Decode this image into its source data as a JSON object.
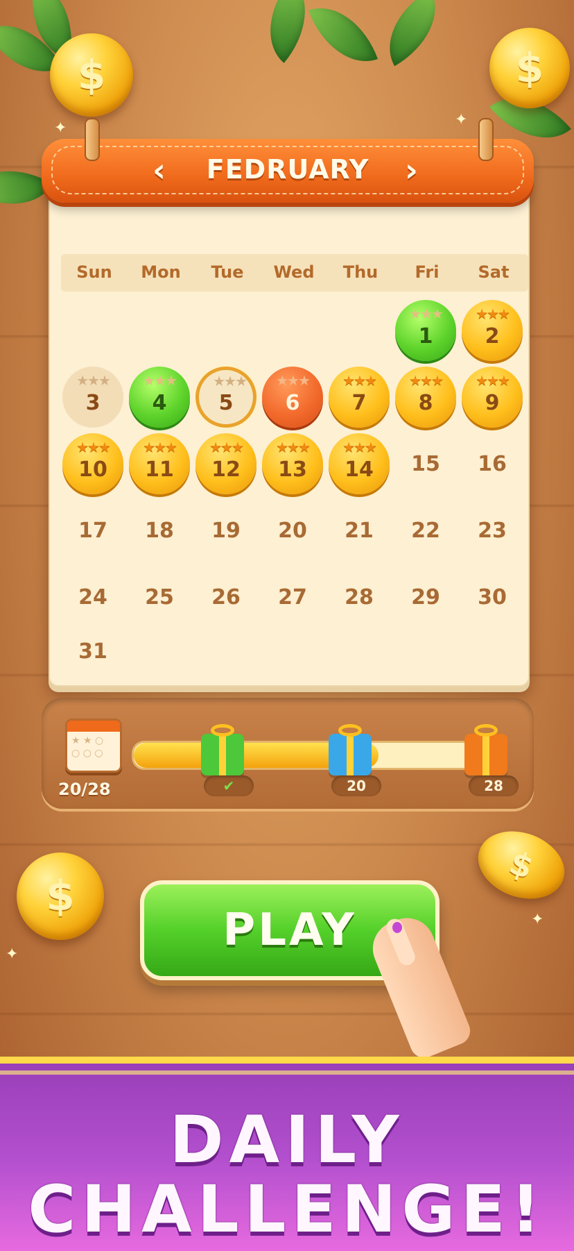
{
  "calendar": {
    "month": "FEDRUARY",
    "prev_label": "‹",
    "next_label": "›",
    "weekdays": [
      "Sun",
      "Mon",
      "Tue",
      "Wed",
      "Thu",
      "Fri",
      "Sat"
    ],
    "days": [
      {
        "num": "1",
        "state": "green",
        "stars": "★★★"
      },
      {
        "num": "2",
        "state": "gold",
        "stars": "★★★"
      },
      {
        "num": "3",
        "state": "pale",
        "stars": "★★★"
      },
      {
        "num": "4",
        "state": "green",
        "stars": "★★★"
      },
      {
        "num": "5",
        "state": "today",
        "stars": "★★★"
      },
      {
        "num": "6",
        "state": "red",
        "stars": "★★★"
      },
      {
        "num": "7",
        "state": "gold",
        "stars": "★★★"
      },
      {
        "num": "8",
        "state": "gold",
        "stars": "★★★"
      },
      {
        "num": "9",
        "state": "gold",
        "stars": "★★★"
      },
      {
        "num": "10",
        "state": "gold",
        "stars": "★★★"
      },
      {
        "num": "11",
        "state": "gold",
        "stars": "★★★"
      },
      {
        "num": "12",
        "state": "gold",
        "stars": "★★★"
      },
      {
        "num": "13",
        "state": "gold",
        "stars": "★★★"
      },
      {
        "num": "14",
        "state": "gold",
        "stars": "★★★"
      },
      {
        "num": "15",
        "state": "plain",
        "stars": ""
      },
      {
        "num": "16",
        "state": "plain",
        "stars": ""
      },
      {
        "num": "17",
        "state": "plain",
        "stars": ""
      },
      {
        "num": "18",
        "state": "plain",
        "stars": ""
      },
      {
        "num": "19",
        "state": "plain",
        "stars": ""
      },
      {
        "num": "20",
        "state": "plain",
        "stars": ""
      },
      {
        "num": "21",
        "state": "plain",
        "stars": ""
      },
      {
        "num": "22",
        "state": "plain",
        "stars": ""
      },
      {
        "num": "23",
        "state": "plain",
        "stars": ""
      },
      {
        "num": "24",
        "state": "plain",
        "stars": ""
      },
      {
        "num": "25",
        "state": "plain",
        "stars": ""
      },
      {
        "num": "26",
        "state": "plain",
        "stars": ""
      },
      {
        "num": "27",
        "state": "plain",
        "stars": ""
      },
      {
        "num": "28",
        "state": "plain",
        "stars": ""
      },
      {
        "num": "29",
        "state": "plain",
        "stars": ""
      },
      {
        "num": "30",
        "state": "plain",
        "stars": ""
      },
      {
        "num": "31",
        "state": "plain",
        "stars": ""
      }
    ],
    "first_weekday_index": 5
  },
  "progress": {
    "count_label": "20/28",
    "fill_fraction": 0.72,
    "milestones": [
      {
        "label": "✔",
        "color": "#4cc83a"
      },
      {
        "label": "20",
        "color": "#3aa8e8"
      },
      {
        "label": "28",
        "color": "#f07a1c"
      }
    ]
  },
  "play_label": "PLAY",
  "banner": {
    "line1": "DAILY",
    "line2": "CHALLENGE!"
  },
  "colors": {
    "accent": "#f06a1c",
    "play": "#54d02a",
    "banner": "#b24fce"
  },
  "icons": [
    "coin-icon",
    "calendar-icon",
    "gift-icon",
    "check-icon",
    "hand-pointer-icon",
    "chevron-left-icon",
    "chevron-right-icon"
  ]
}
